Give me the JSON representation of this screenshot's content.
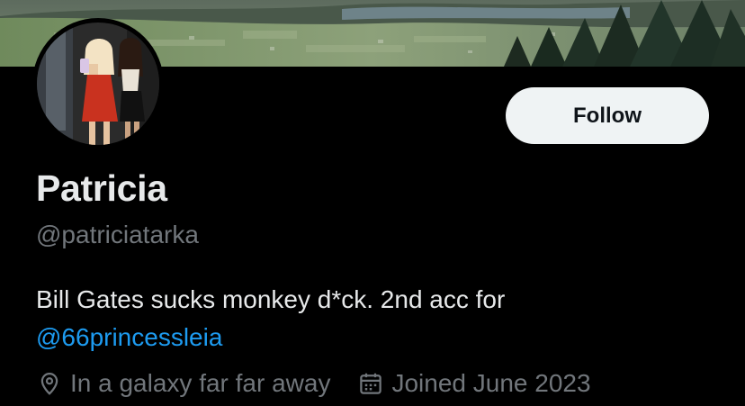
{
  "profile": {
    "display_name": "Patricia",
    "handle": "@patriciatarka",
    "bio_text": "Bill Gates sucks monkey d*ck. 2nd acc for",
    "bio_mention": "@66princessleia",
    "location": "In a galaxy far far away",
    "joined": "Joined June 2023"
  },
  "actions": {
    "follow_label": "Follow"
  },
  "icons": {
    "location": "map-pin-icon",
    "joined": "calendar-icon"
  },
  "colors": {
    "background": "#000000",
    "primary_text": "#e7e9ea",
    "secondary_text": "#71767b",
    "link": "#1d9bf0",
    "follow_button_bg": "#eff3f4",
    "follow_button_text": "#0f1419"
  }
}
